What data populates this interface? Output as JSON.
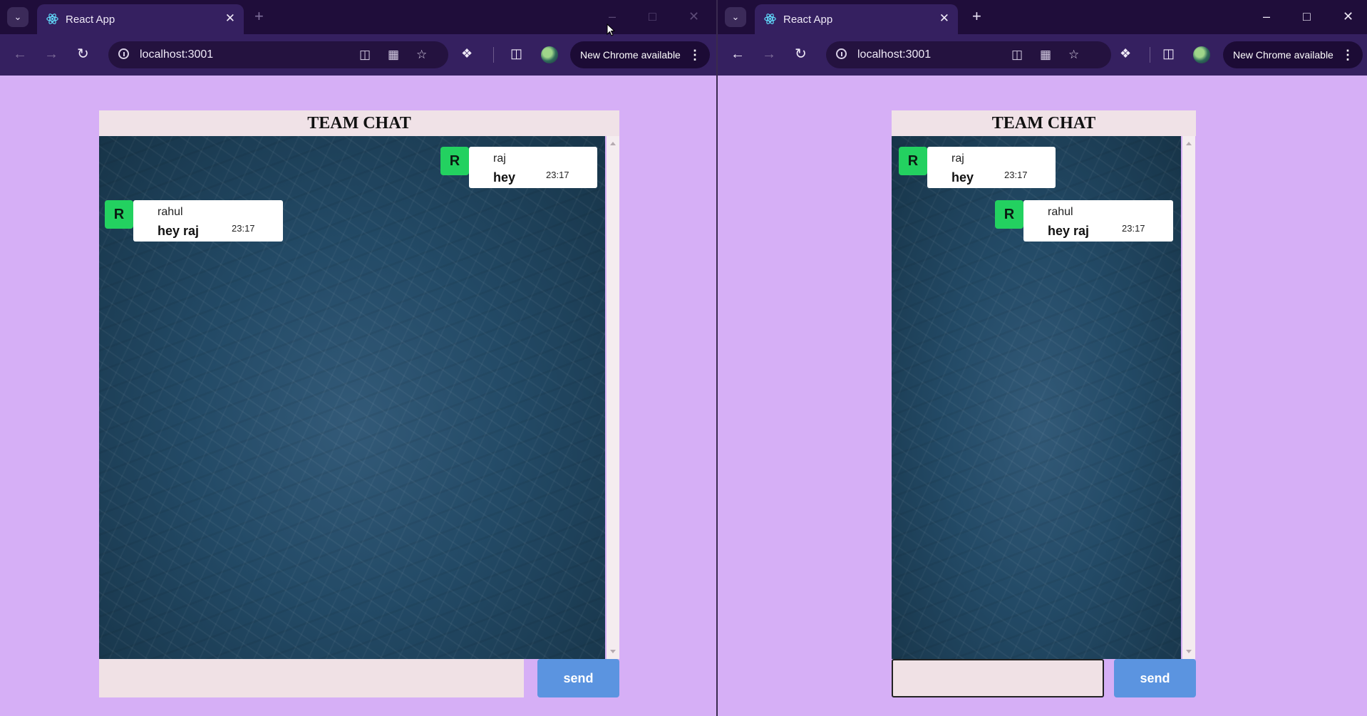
{
  "windows": [
    {
      "tab": {
        "title": "React App"
      },
      "toolbar": {
        "url": "localhost:3001",
        "update_label": "New Chrome available"
      },
      "chat": {
        "title": "TEAM CHAT",
        "messages": [
          {
            "avatar": "R",
            "sender": "raj",
            "text": "hey",
            "time": "23:17"
          },
          {
            "avatar": "R",
            "sender": "rahul",
            "text": "hey raj",
            "time": "23:17"
          }
        ],
        "input": {
          "value": "",
          "placeholder": ""
        },
        "send_label": "send"
      }
    },
    {
      "tab": {
        "title": "React App"
      },
      "toolbar": {
        "url": "localhost:3001",
        "update_label": "New Chrome available"
      },
      "chat": {
        "title": "TEAM CHAT",
        "messages": [
          {
            "avatar": "R",
            "sender": "raj",
            "text": "hey",
            "time": "23:17"
          },
          {
            "avatar": "R",
            "sender": "rahul",
            "text": "hey raj",
            "time": "23:17"
          }
        ],
        "input": {
          "value": "",
          "placeholder": ""
        },
        "send_label": "send"
      }
    }
  ],
  "icons": {
    "tab_menu": "chevron-down-icon",
    "favicon": "react-icon",
    "tab_close": "close-icon",
    "new_tab": "plus-icon",
    "back": "back-arrow-icon",
    "forward": "forward-arrow-icon",
    "reload": "reload-icon",
    "site_info": "info-icon",
    "bookmark": "star-icon",
    "extensions": "puzzle-icon",
    "side_panel": "side-panel-icon",
    "menu": "three-dots-icon"
  },
  "colors": {
    "page_background": "#d6aff6",
    "browser_frame": "#352060",
    "avatar": "#23d160",
    "send_button": "#5b94e0",
    "chat_header": "#f0e2e7"
  }
}
